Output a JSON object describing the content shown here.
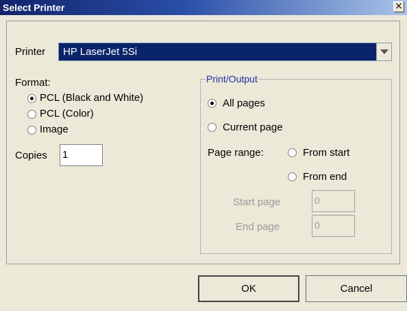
{
  "window": {
    "title": "Select Printer",
    "close_glyph": "×"
  },
  "printer": {
    "label": "Printer",
    "selected": "HP LaserJet 5Si"
  },
  "format": {
    "label": "Format:",
    "options": [
      "PCL (Black and White)",
      "PCL (Color)",
      "Image"
    ],
    "selected_index": 0
  },
  "copies": {
    "label": "Copies",
    "value": "1"
  },
  "output": {
    "title": "Print/Output",
    "all_pages": "All pages",
    "current_page": "Current page",
    "page_range_label": "Page range:",
    "from_start": "From start",
    "from_end": "From end",
    "selected": "all_pages",
    "start_page_label": "Start page",
    "start_page_value": "0",
    "end_page_label": "End page",
    "end_page_value": "0"
  },
  "buttons": {
    "ok": "OK",
    "cancel": "Cancel"
  },
  "colors": {
    "title_start": "#12246c",
    "title_end": "#a9c4e8",
    "dialog_bg": "#ece9d8",
    "selection_bg": "#0a246a",
    "group_title": "#1b2ca8"
  }
}
